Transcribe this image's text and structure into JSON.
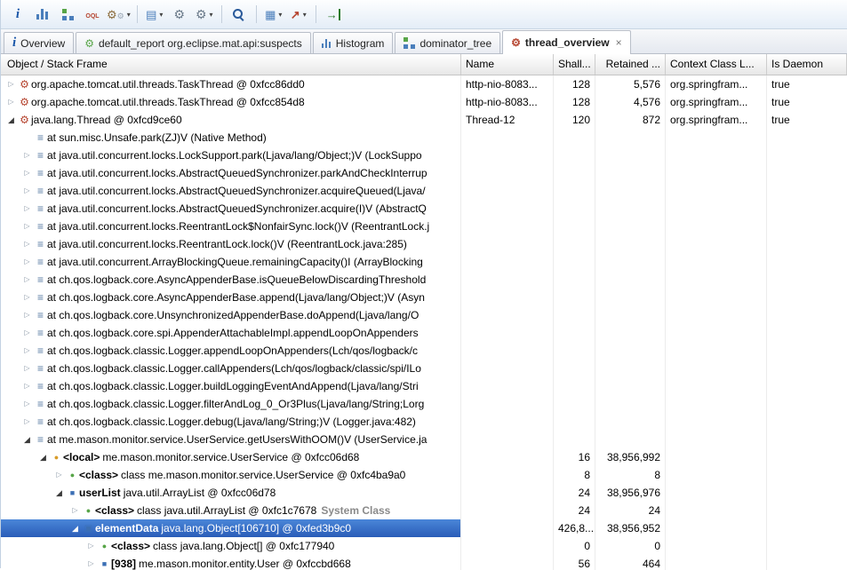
{
  "toolbar": {
    "items": [
      {
        "name": "overview",
        "icon": "info"
      },
      {
        "name": "histogram",
        "icon": "histogram"
      },
      {
        "name": "dominator-tree",
        "icon": "tree"
      },
      {
        "name": "oql",
        "icon": "oql"
      },
      {
        "name": "run-expert-report",
        "icon": "gears",
        "dropdown": true
      },
      {
        "type": "sep"
      },
      {
        "name": "heap-dump-history",
        "icon": "list",
        "dropdown": true
      },
      {
        "name": "acquire-heap-dump",
        "icon": "gear"
      },
      {
        "name": "run-report",
        "icon": "gear",
        "dropdown": true
      },
      {
        "type": "sep"
      },
      {
        "name": "search",
        "icon": "magnifier"
      },
      {
        "type": "sep"
      },
      {
        "name": "table-view",
        "icon": "grid",
        "dropdown": true
      },
      {
        "name": "chart-view",
        "icon": "chart",
        "dropdown": true
      },
      {
        "type": "sep"
      },
      {
        "name": "compare-to-another",
        "icon": "import"
      }
    ]
  },
  "tabs": [
    {
      "label": "Overview"
    },
    {
      "label": "default_report org.eclipse.mat.api:suspects"
    },
    {
      "label": "Histogram"
    },
    {
      "label": "dominator_tree"
    },
    {
      "label": "thread_overview",
      "active": true,
      "close_glyph": "×"
    }
  ],
  "table": {
    "columns": [
      {
        "label": "Object / Stack Frame"
      },
      {
        "label": "Name"
      },
      {
        "label": "Shall..."
      },
      {
        "label": "Retained ..."
      },
      {
        "label": "Context Class L..."
      },
      {
        "label": "Is Daemon"
      }
    ],
    "rows": [
      {
        "level": 0,
        "arrow": "col",
        "icon": "thread",
        "text": "org.apache.tomcat.util.threads.TaskThread @ 0xfcc86dd0",
        "name": "http-nio-8083...",
        "shallow": "128",
        "retained": "5,576",
        "context": "org.springfram...",
        "daemon": "true"
      },
      {
        "level": 0,
        "arrow": "col",
        "icon": "thread",
        "text": "org.apache.tomcat.util.threads.TaskThread @ 0xfcc854d8",
        "name": "http-nio-8083...",
        "shallow": "128",
        "retained": "4,576",
        "context": "org.springfram...",
        "daemon": "true"
      },
      {
        "level": 0,
        "arrow": "exp",
        "icon": "thread",
        "text": "java.lang.Thread @ 0xfcd9ce60",
        "name": "Thread-12",
        "shallow": "120",
        "retained": "872",
        "context": "org.springfram...",
        "daemon": "true"
      },
      {
        "level": 1,
        "arrow": "none",
        "icon": "frame",
        "text": "at sun.misc.Unsafe.park(ZJ)V (Native Method)"
      },
      {
        "level": 1,
        "arrow": "col",
        "icon": "frame",
        "text": "at java.util.concurrent.locks.LockSupport.park(Ljava/lang/Object;)V (LockSuppo"
      },
      {
        "level": 1,
        "arrow": "col",
        "icon": "frame",
        "text": "at java.util.concurrent.locks.AbstractQueuedSynchronizer.parkAndCheckInterrup"
      },
      {
        "level": 1,
        "arrow": "col",
        "icon": "frame",
        "text": "at java.util.concurrent.locks.AbstractQueuedSynchronizer.acquireQueued(Ljava/"
      },
      {
        "level": 1,
        "arrow": "col",
        "icon": "frame",
        "text": "at java.util.concurrent.locks.AbstractQueuedSynchronizer.acquire(I)V (AbstractQ"
      },
      {
        "level": 1,
        "arrow": "col",
        "icon": "frame",
        "text": "at java.util.concurrent.locks.ReentrantLock$NonfairSync.lock()V (ReentrantLock.j"
      },
      {
        "level": 1,
        "arrow": "col",
        "icon": "frame",
        "text": "at java.util.concurrent.locks.ReentrantLock.lock()V (ReentrantLock.java:285)"
      },
      {
        "level": 1,
        "arrow": "col",
        "icon": "frame",
        "text": "at java.util.concurrent.ArrayBlockingQueue.remainingCapacity()I (ArrayBlocking"
      },
      {
        "level": 1,
        "arrow": "col",
        "icon": "frame",
        "text": "at ch.qos.logback.core.AsyncAppenderBase.isQueueBelowDiscardingThreshold"
      },
      {
        "level": 1,
        "arrow": "col",
        "icon": "frame",
        "text": "at ch.qos.logback.core.AsyncAppenderBase.append(Ljava/lang/Object;)V (Asyn"
      },
      {
        "level": 1,
        "arrow": "col",
        "icon": "frame",
        "text": "at ch.qos.logback.core.UnsynchronizedAppenderBase.doAppend(Ljava/lang/O"
      },
      {
        "level": 1,
        "arrow": "col",
        "icon": "frame",
        "text": "at ch.qos.logback.core.spi.AppenderAttachableImpl.appendLoopOnAppenders"
      },
      {
        "level": 1,
        "arrow": "col",
        "icon": "frame",
        "text": "at ch.qos.logback.classic.Logger.appendLoopOnAppenders(Lch/qos/logback/c"
      },
      {
        "level": 1,
        "arrow": "col",
        "icon": "frame",
        "text": "at ch.qos.logback.classic.Logger.callAppenders(Lch/qos/logback/classic/spi/ILo"
      },
      {
        "level": 1,
        "arrow": "col",
        "icon": "frame",
        "text": "at ch.qos.logback.classic.Logger.buildLoggingEventAndAppend(Ljava/lang/Stri"
      },
      {
        "level": 1,
        "arrow": "col",
        "icon": "frame",
        "text": "at ch.qos.logback.classic.Logger.filterAndLog_0_Or3Plus(Ljava/lang/String;Lorg"
      },
      {
        "level": 1,
        "arrow": "col",
        "icon": "frame",
        "text": "at ch.qos.logback.classic.Logger.debug(Ljava/lang/String;)V (Logger.java:482)"
      },
      {
        "level": 1,
        "arrow": "exp",
        "icon": "frame",
        "text": "at me.mason.monitor.service.UserService.getUsersWithOOM()V (UserService.ja"
      },
      {
        "level": 2,
        "arrow": "exp",
        "icon": "local",
        "prefix": "<local>",
        "text": "me.mason.monitor.service.UserService @ 0xfcc06d68",
        "shallow": "16",
        "retained": "38,956,992"
      },
      {
        "level": 3,
        "arrow": "col",
        "icon": "class",
        "prefix": "<class>",
        "text": "class me.mason.monitor.service.UserService @ 0xfc4ba9a0",
        "shallow": "8",
        "retained": "8"
      },
      {
        "level": 3,
        "arrow": "exp",
        "icon": "object",
        "prefix": "userList",
        "text": "java.util.ArrayList @ 0xfcc06d78",
        "shallow": "24",
        "retained": "38,956,976"
      },
      {
        "level": 4,
        "arrow": "col",
        "icon": "class",
        "prefix": "<class>",
        "text": "class java.util.ArrayList @ 0xfc1c7678",
        "suffix": "System Class",
        "shallow": "24",
        "retained": "24"
      },
      {
        "level": 4,
        "arrow": "exp",
        "icon": "array",
        "prefix": "elementData",
        "text": "java.lang.Object[106710] @ 0xfed3b9c0",
        "shallow": "426,8...",
        "retained": "38,956,952",
        "selected": true
      },
      {
        "level": 5,
        "arrow": "col",
        "icon": "class",
        "prefix": "<class>",
        "text": "class java.lang.Object[] @ 0xfc177940",
        "shallow": "0",
        "retained": "0"
      },
      {
        "level": 5,
        "arrow": "col",
        "icon": "object",
        "prefix": "[938]",
        "text": "me.mason.monitor.entity.User @ 0xfccbd668",
        "shallow": "56",
        "retained": "464"
      }
    ]
  },
  "colors": {
    "selection": "#316ac5",
    "toolbar_tint": "#e4edf7",
    "gridline": "#ececec"
  }
}
